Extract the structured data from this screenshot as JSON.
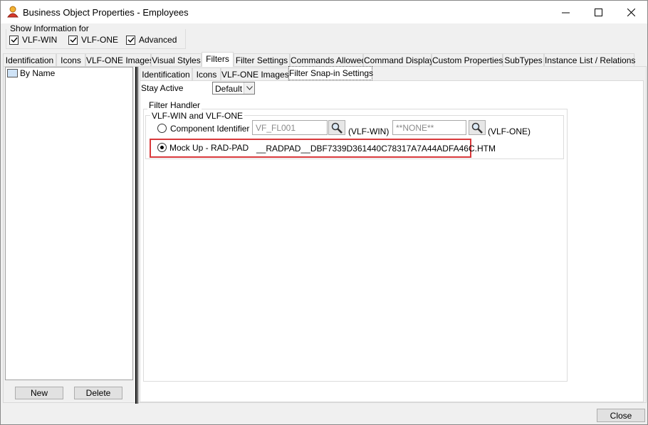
{
  "window": {
    "title": "Business Object Properties - Employees",
    "icons": {
      "app": "person-icon",
      "minimize": "minimize-icon",
      "maximize": "maximize-icon",
      "close": "close-icon"
    }
  },
  "show_info": {
    "label": "Show Information for",
    "options": [
      {
        "label": "VLF-WIN",
        "checked": true
      },
      {
        "label": "VLF-ONE",
        "checked": true
      },
      {
        "label": "Advanced",
        "checked": true
      }
    ]
  },
  "main_tabs": [
    "Identification",
    "Icons",
    "VLF-ONE Images",
    "Visual Styles",
    "Filters",
    "Filter Settings",
    "Commands Allowed",
    "Command Display",
    "Custom Properties",
    "SubTypes",
    "Instance List / Relations"
  ],
  "main_tabs_active": "Filters",
  "left_list": {
    "items": [
      {
        "label": "By Name",
        "icon": "filter-list-icon"
      }
    ]
  },
  "left_buttons": {
    "new": "New",
    "delete": "Delete"
  },
  "sub_tabs": [
    "Identification",
    "Icons",
    "VLF-ONE Images",
    "Filter Snap-in Settings"
  ],
  "sub_tabs_active": "Filter Snap-in Settings",
  "stay_active": {
    "label": "Stay Active",
    "value": "Default"
  },
  "filter_handler": {
    "label": "Filter Handler",
    "group_label": "VLF-WIN and VLF-ONE",
    "component_identifier": {
      "label": "Component Identifier",
      "win_value": "VF_FL001",
      "win_suffix": "(VLF-WIN)",
      "one_value": "**NONE**",
      "one_suffix": "(VLF-ONE)",
      "selected": false
    },
    "mock_up": {
      "label": "Mock Up - RAD-PAD",
      "value": "__RADPAD__DBF7339D361440C78317A7A44ADFA46C.HTM",
      "selected": true
    }
  },
  "footer": {
    "close": "Close"
  },
  "colors": {
    "highlight_border": "#d9393b",
    "window_bg": "#f0f0f0"
  }
}
